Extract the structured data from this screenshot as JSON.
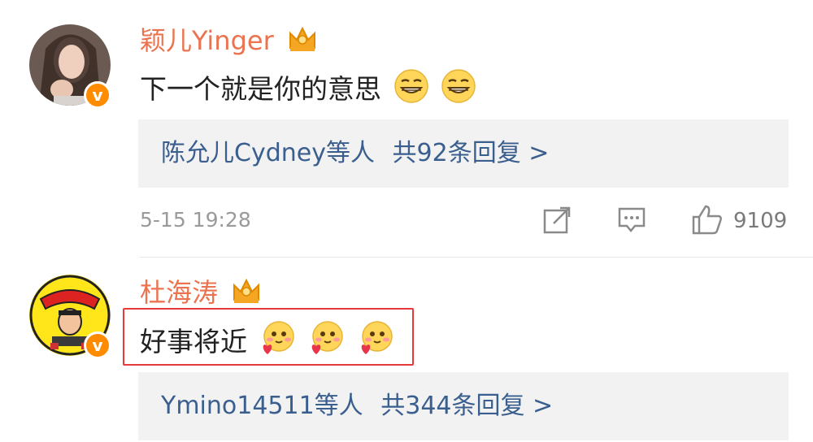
{
  "comments": [
    {
      "username": "颖儿Yinger",
      "text": "下一个就是你的意思",
      "emojis": [
        "grin-emoji",
        "grin-emoji"
      ],
      "replies": {
        "who": "陈允儿Cydney等人",
        "count": "共92条回复 >"
      },
      "time": "5-15 19:28",
      "likes": "9109",
      "verified_badge": "v"
    },
    {
      "username": "杜海涛",
      "text": "好事将近",
      "emojis": [
        "blush-heart-emoji",
        "blush-heart-emoji",
        "blush-heart-emoji"
      ],
      "replies": {
        "who": "Ymino14511等人",
        "count": "共344条回复 >"
      },
      "verified_badge": "v"
    }
  ],
  "colors": {
    "username": "#eb7350",
    "reply_link": "#3a5f8f",
    "badge": "#ff8c00",
    "highlight": "#e53a3a"
  }
}
